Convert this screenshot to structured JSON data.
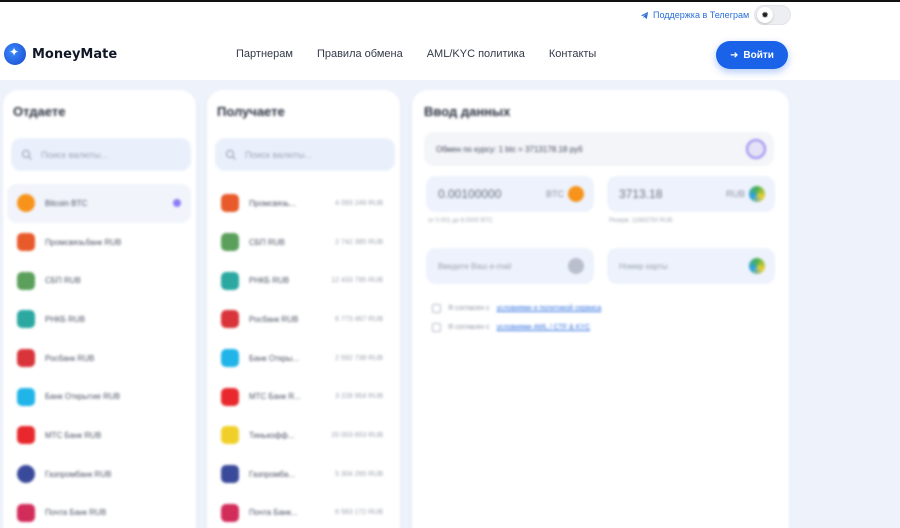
{
  "topbar": {
    "telegram_label": "Поддержка в Телеграм",
    "theme_toggle_icon": "sun-icon"
  },
  "header": {
    "logo_text": "MoneyMate",
    "nav": [
      "Партнерам",
      "Правила обмена",
      "AML/KYC политика",
      "Контакты"
    ],
    "login_label": "Войти"
  },
  "give": {
    "title": "Отдаете",
    "search_placeholder": "Поиск валюты...",
    "items": [
      {
        "label": "Bitcoin BTC",
        "color": "#f7931a",
        "shape": "round"
      },
      {
        "label": "Промсвязьбанк RUB",
        "color": "#e85a2a",
        "shape": "flag"
      },
      {
        "label": "СБП RUB",
        "color": "#5aa05a",
        "shape": "flag"
      },
      {
        "label": "РНКБ RUB",
        "color": "#2ba8a0",
        "shape": "flag"
      },
      {
        "label": "Росбанк RUB",
        "color": "#d8343a",
        "shape": "flag"
      },
      {
        "label": "Банк Открытие RUB",
        "color": "#20b4e8",
        "shape": "sq"
      },
      {
        "label": "МТС Банк RUB",
        "color": "#e8282c",
        "shape": "sq"
      },
      {
        "label": "Газпромбанк RUB",
        "color": "#3a4a9a",
        "shape": "round"
      },
      {
        "label": "Почта Банк RUB",
        "color": "#d22c5a",
        "shape": "sq"
      }
    ]
  },
  "get": {
    "title": "Получаете",
    "search_placeholder": "Поиск валюты...",
    "items": [
      {
        "label": "Промсвязь...",
        "amount": "4 093 249 RUB",
        "color": "#e85a2a"
      },
      {
        "label": "СБП RUB",
        "amount": "2 742 385 RUB",
        "color": "#5aa05a"
      },
      {
        "label": "РНКБ RUB",
        "amount": "12 433 795 RUB",
        "color": "#2ba8a0"
      },
      {
        "label": "Росбанк RUB",
        "amount": "6 773 467 RUB",
        "color": "#d8343a"
      },
      {
        "label": "Банк Откры...",
        "amount": "2 592 738 RUB",
        "color": "#20b4e8"
      },
      {
        "label": "МТС Банк R...",
        "amount": "3 228 954 RUB",
        "color": "#e8282c"
      },
      {
        "label": "Тинькофф...",
        "amount": "20 003 653 RUB",
        "color": "#f0d028"
      },
      {
        "label": "Газпромба...",
        "amount": "5 304 265 RUB",
        "color": "#3a4a9a"
      },
      {
        "label": "Почта Банк...",
        "amount": "6 563 172 RUB",
        "color": "#d22c5a"
      }
    ]
  },
  "input": {
    "title": "Ввод данных",
    "rate": "Обмен по курсу: 1 btc = 3713178.18 руб",
    "give_amount": "0.00100000",
    "give_currency": "BTC",
    "give_hint": "от 0.001 до 8.0000 BTC",
    "get_amount": "3713.18",
    "get_currency": "RUB",
    "get_hint": "Резерв: 11683750 RUB",
    "field1_placeholder": "Введите Ваш e-mail",
    "field2_placeholder": "Номер карты",
    "check1_text": "Я согласен с",
    "check1_link": "условиями и политикой сервиса",
    "check2_text": "Я согласен с",
    "check2_link": "условиями AML / CTF & KYC",
    "colors": {
      "btc": "#f7931a",
      "rub": "#4caf50",
      "accent": "#1a63e8"
    }
  }
}
